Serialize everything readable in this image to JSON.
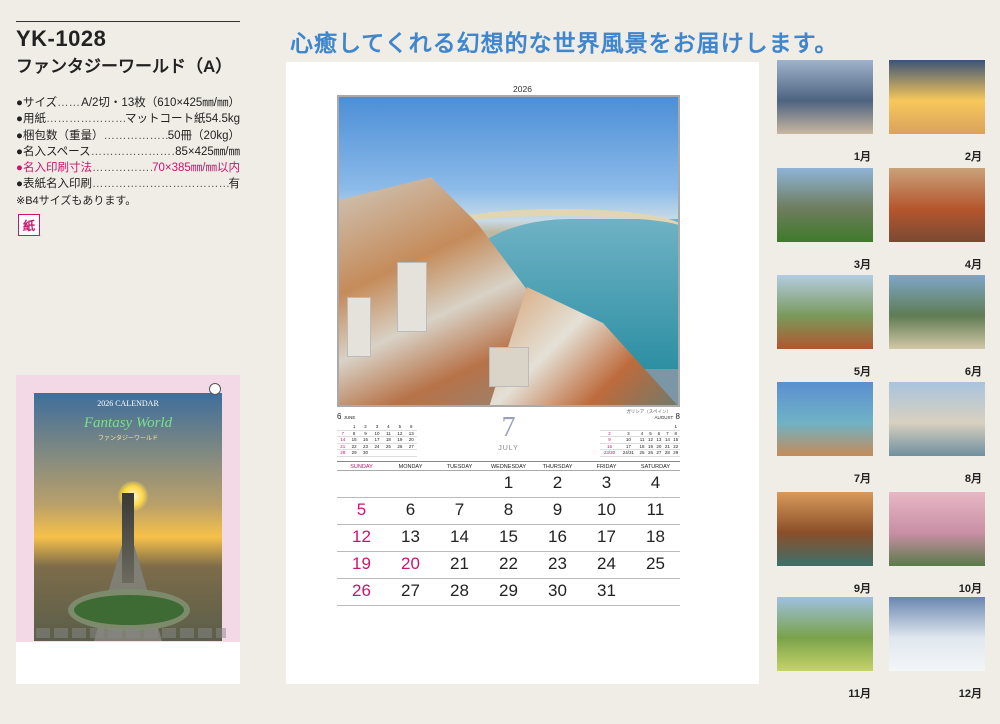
{
  "product": {
    "code": "YK-1028",
    "name": "ファンタジーワールド（A）"
  },
  "specs": [
    {
      "label": "●サイズ",
      "value": "A/2切・13枚（610×425㎜/㎜）",
      "highlight": false
    },
    {
      "label": "●用紙",
      "value": "マットコート紙54.5kg",
      "highlight": false
    },
    {
      "label": "●梱包数（重量）",
      "value": "50冊（20kg）",
      "highlight": false
    },
    {
      "label": "●名入スペース",
      "value": "85×425㎜/㎜",
      "highlight": false
    },
    {
      "label": "●名入印刷寸法",
      "value": "70×385㎜/㎜以内",
      "highlight": true
    },
    {
      "label": "●表紙名入印刷",
      "value": "有",
      "highlight": false
    }
  ],
  "spec_note": "※B4サイズもあります。",
  "paper_badge": "紙",
  "cover": {
    "title": "2026 CALENDAR",
    "script_title": "Fantasy World",
    "subtitle": "ファンタジーワールド"
  },
  "headline": "心癒してくれる幻想的な世界風景をお届けします。",
  "calendar": {
    "year": "2026",
    "month_number": "7",
    "month_name": "JULY",
    "photo_caption": "ガリシア（スペイン）",
    "prev_month": {
      "number": "6",
      "name": "JUNE",
      "weeks": [
        [
          "",
          "1",
          "2",
          "3",
          "4",
          "5",
          "6"
        ],
        [
          "7",
          "8",
          "9",
          "10",
          "11",
          "12",
          "13"
        ],
        [
          "14",
          "15",
          "16",
          "17",
          "18",
          "19",
          "20"
        ],
        [
          "21",
          "22",
          "23",
          "24",
          "25",
          "26",
          "27"
        ],
        [
          "28",
          "29",
          "30",
          "",
          "",
          "",
          ""
        ]
      ]
    },
    "next_month": {
      "number": "8",
      "name": "AUGUST",
      "weeks": [
        [
          "",
          "",
          "",
          "",
          "",
          "",
          "1"
        ],
        [
          "2",
          "3",
          "4",
          "5",
          "6",
          "7",
          "8"
        ],
        [
          "9",
          "10",
          "11",
          "12",
          "13",
          "14",
          "15"
        ],
        [
          "16",
          "17",
          "18",
          "19",
          "20",
          "21",
          "22"
        ],
        [
          "23/30",
          "24/31",
          "25",
          "26",
          "27",
          "28",
          "29"
        ]
      ]
    },
    "weekdays": [
      "SUNDAY",
      "MONDAY",
      "TUESDAY",
      "WEDNESDAY",
      "THURSDAY",
      "FRIDAY",
      "SATURDAY"
    ],
    "weeks": [
      [
        "",
        "",
        "",
        "1",
        "2",
        "3",
        "4"
      ],
      [
        "5",
        "6",
        "7",
        "8",
        "9",
        "10",
        "11"
      ],
      [
        "12",
        "13",
        "14",
        "15",
        "16",
        "17",
        "18"
      ],
      [
        "19",
        "20",
        "21",
        "22",
        "23",
        "24",
        "25"
      ],
      [
        "26",
        "27",
        "28",
        "29",
        "30",
        "31",
        ""
      ]
    ],
    "holidays": [
      "20"
    ]
  },
  "thumbnails": [
    {
      "label": "1月",
      "colors": [
        "#9fb3cc",
        "#4d6380",
        "#c9b7a0"
      ]
    },
    {
      "label": "2月",
      "colors": [
        "#3b5478",
        "#f7c85a",
        "#d9a25d"
      ]
    },
    {
      "label": "3月",
      "colors": [
        "#8fb3d6",
        "#6e7d5e",
        "#3f7a2a"
      ]
    },
    {
      "label": "4月",
      "colors": [
        "#c9a27a",
        "#b5562e",
        "#7a4a33"
      ]
    },
    {
      "label": "5月",
      "colors": [
        "#b4cce3",
        "#7a9a5c",
        "#b0562f"
      ]
    },
    {
      "label": "6月",
      "colors": [
        "#7fa6c9",
        "#5f7c53",
        "#d3c7a7"
      ]
    },
    {
      "label": "7月",
      "colors": [
        "#5b8fd0",
        "#6fb2c5",
        "#c58b5a"
      ]
    },
    {
      "label": "8月",
      "colors": [
        "#a9c4de",
        "#d8d0bf",
        "#6f8fa0"
      ]
    },
    {
      "label": "9月",
      "colors": [
        "#d89a5a",
        "#8a4f2a",
        "#3e6f6a"
      ]
    },
    {
      "label": "10月",
      "colors": [
        "#e7b8c5",
        "#c98fa5",
        "#5b7a4a"
      ]
    },
    {
      "label": "11月",
      "colors": [
        "#9fc0e0",
        "#7aa24a",
        "#c6d36a"
      ]
    },
    {
      "label": "12月",
      "colors": [
        "#6a86b0",
        "#dfe7ee",
        "#f4f6f8"
      ]
    }
  ]
}
